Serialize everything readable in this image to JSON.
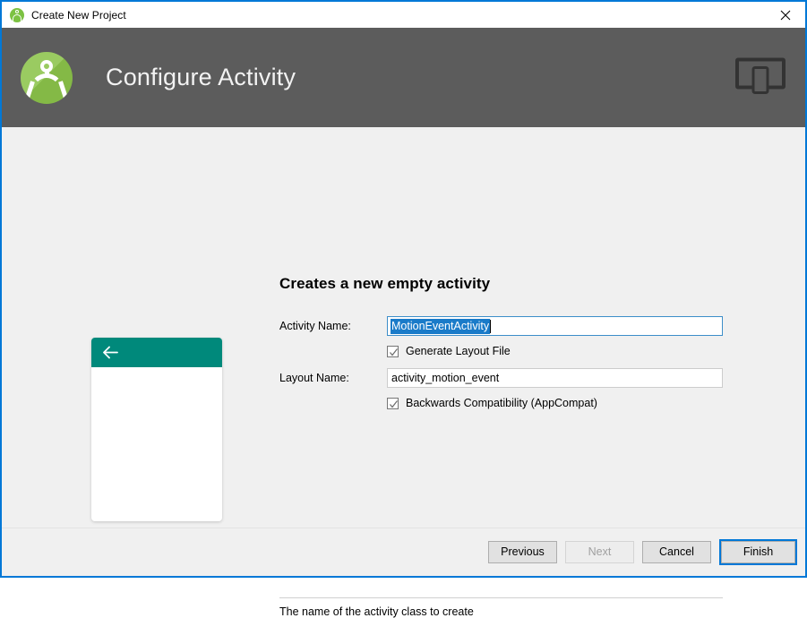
{
  "window": {
    "title": "Create New Project",
    "title_icon": "android-studio-icon",
    "close_icon": "close-icon",
    "accent_color": "#0078d7"
  },
  "header": {
    "title": "Configure Activity",
    "logo_icon": "android-studio-logo",
    "device_icon": "tablet-device-icon",
    "background_color": "#5c5c5c",
    "text_color": "#f2f2f2"
  },
  "preview": {
    "name": "activity-preview",
    "appbar_color": "#00897b",
    "back_icon": "arrow-back-icon",
    "canvas_color": "#ffffff"
  },
  "form": {
    "heading": "Creates a new empty activity",
    "activity_name": {
      "label": "Activity Name:",
      "value": "MotionEventActivity",
      "placeholder": "Activity Name",
      "selected": true,
      "focused": true,
      "selection_color": "#1a7bc9"
    },
    "generate_layout": {
      "label": "Generate Layout File",
      "checked": true
    },
    "layout_name": {
      "label": "Layout Name:",
      "value": "activity_motion_event",
      "placeholder": "Layout Name",
      "selected": false,
      "focused": false
    },
    "backwards_compat": {
      "label": "Backwards Compatibility (AppCompat)",
      "checked": true
    }
  },
  "help": {
    "text": "The name of the activity class to create"
  },
  "buttons": {
    "previous": {
      "label": "Previous",
      "enabled": true
    },
    "next": {
      "label": "Next",
      "enabled": false
    },
    "cancel": {
      "label": "Cancel",
      "enabled": true
    },
    "finish": {
      "label": "Finish",
      "enabled": true,
      "focused": true
    }
  }
}
